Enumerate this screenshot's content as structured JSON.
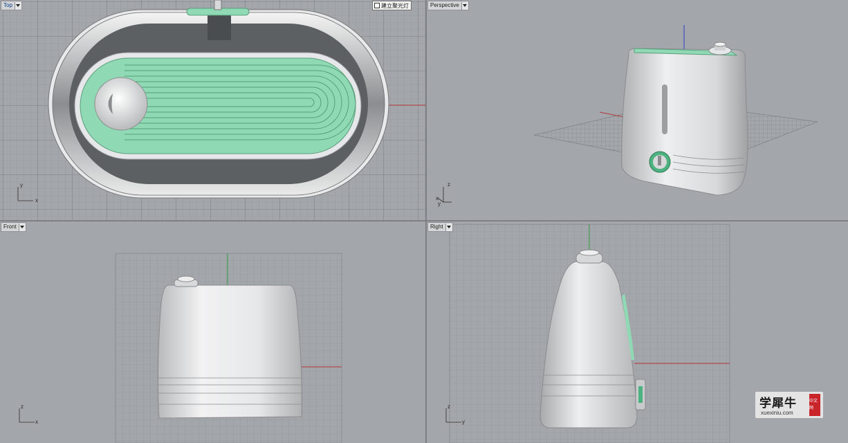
{
  "viewports": {
    "top": {
      "label": "Top",
      "active": true,
      "fix_light_label": "建立聚光灯",
      "axes": {
        "vertical": "y",
        "horizontal": "x"
      }
    },
    "perspective": {
      "label": "Perspective",
      "active": false,
      "axes": {
        "vertical": "z",
        "depth": "y",
        "horizontal": "x"
      }
    },
    "front": {
      "label": "Front",
      "active": false,
      "axes": {
        "vertical": "z",
        "horizontal": "x"
      }
    },
    "right": {
      "label": "Right",
      "active": false,
      "axes": {
        "vertical": "z",
        "horizontal": "y"
      }
    }
  },
  "colors": {
    "viewport_bg": "#a3a6aa",
    "grid_line": "#8f9296",
    "grid_major": "#6f7276",
    "x_axis": "#b2363a",
    "y_axis": "#2f9a3d",
    "z_axis": "#2e3ec2",
    "model_mint": "#8fd9b4",
    "model_shell": "#d6d8d9",
    "dropdown_icon": "chevron-down-icon"
  },
  "watermark": {
    "main": "学犀牛",
    "url": "xuexiniu.com",
    "seal": "中文网"
  }
}
